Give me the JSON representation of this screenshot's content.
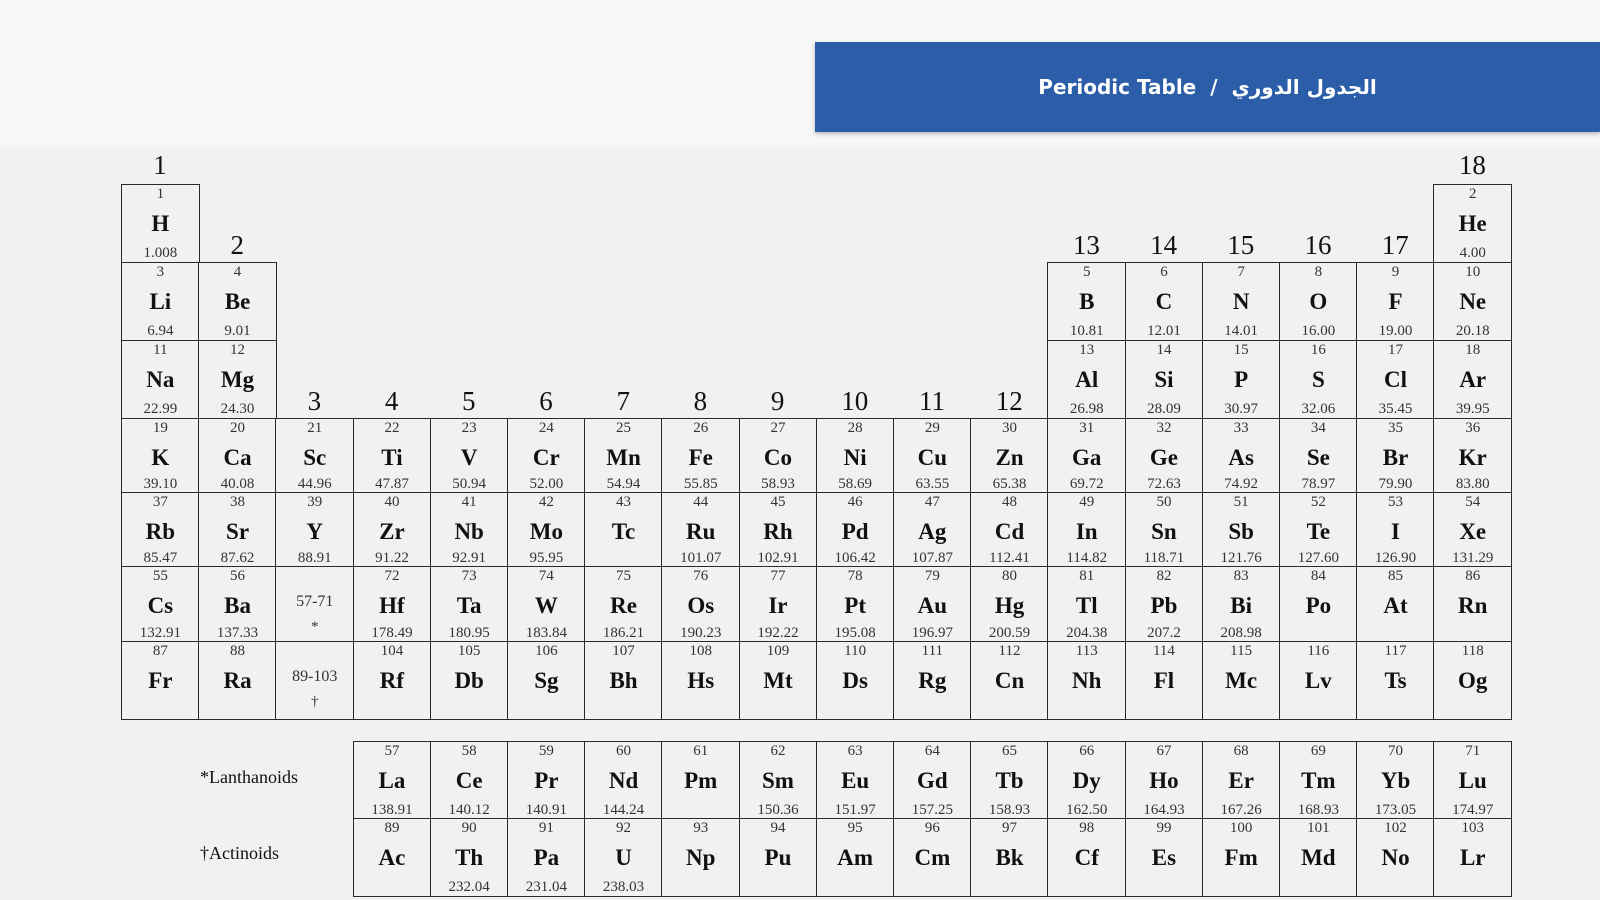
{
  "header": {
    "title_en": "Periodic Table",
    "separator": "/",
    "title_ar": "الجدول الدوري"
  },
  "colors": {
    "banner": "#2b5da9",
    "banner_text": "#ffffff",
    "cell_border": "#2a2a2a",
    "page_background": "#f1f1f1"
  },
  "groups": [
    "1",
    "2",
    "3",
    "4",
    "5",
    "6",
    "7",
    "8",
    "9",
    "10",
    "11",
    "12",
    "13",
    "14",
    "15",
    "16",
    "17",
    "18"
  ],
  "elements": [
    {
      "n": "1",
      "s": "H",
      "m": "1.008",
      "g": 1,
      "p": 1
    },
    {
      "n": "2",
      "s": "He",
      "m": "4.00",
      "g": 18,
      "p": 1
    },
    {
      "n": "3",
      "s": "Li",
      "m": "6.94",
      "g": 1,
      "p": 2
    },
    {
      "n": "4",
      "s": "Be",
      "m": "9.01",
      "g": 2,
      "p": 2
    },
    {
      "n": "5",
      "s": "B",
      "m": "10.81",
      "g": 13,
      "p": 2
    },
    {
      "n": "6",
      "s": "C",
      "m": "12.01",
      "g": 14,
      "p": 2
    },
    {
      "n": "7",
      "s": "N",
      "m": "14.01",
      "g": 15,
      "p": 2
    },
    {
      "n": "8",
      "s": "O",
      "m": "16.00",
      "g": 16,
      "p": 2
    },
    {
      "n": "9",
      "s": "F",
      "m": "19.00",
      "g": 17,
      "p": 2
    },
    {
      "n": "10",
      "s": "Ne",
      "m": "20.18",
      "g": 18,
      "p": 2
    },
    {
      "n": "11",
      "s": "Na",
      "m": "22.99",
      "g": 1,
      "p": 3
    },
    {
      "n": "12",
      "s": "Mg",
      "m": "24.30",
      "g": 2,
      "p": 3
    },
    {
      "n": "13",
      "s": "Al",
      "m": "26.98",
      "g": 13,
      "p": 3
    },
    {
      "n": "14",
      "s": "Si",
      "m": "28.09",
      "g": 14,
      "p": 3
    },
    {
      "n": "15",
      "s": "P",
      "m": "30.97",
      "g": 15,
      "p": 3
    },
    {
      "n": "16",
      "s": "S",
      "m": "32.06",
      "g": 16,
      "p": 3
    },
    {
      "n": "17",
      "s": "Cl",
      "m": "35.45",
      "g": 17,
      "p": 3
    },
    {
      "n": "18",
      "s": "Ar",
      "m": "39.95",
      "g": 18,
      "p": 3
    },
    {
      "n": "19",
      "s": "K",
      "m": "39.10",
      "g": 1,
      "p": 4
    },
    {
      "n": "20",
      "s": "Ca",
      "m": "40.08",
      "g": 2,
      "p": 4
    },
    {
      "n": "21",
      "s": "Sc",
      "m": "44.96",
      "g": 3,
      "p": 4
    },
    {
      "n": "22",
      "s": "Ti",
      "m": "47.87",
      "g": 4,
      "p": 4
    },
    {
      "n": "23",
      "s": "V",
      "m": "50.94",
      "g": 5,
      "p": 4
    },
    {
      "n": "24",
      "s": "Cr",
      "m": "52.00",
      "g": 6,
      "p": 4
    },
    {
      "n": "25",
      "s": "Mn",
      "m": "54.94",
      "g": 7,
      "p": 4
    },
    {
      "n": "26",
      "s": "Fe",
      "m": "55.85",
      "g": 8,
      "p": 4
    },
    {
      "n": "27",
      "s": "Co",
      "m": "58.93",
      "g": 9,
      "p": 4
    },
    {
      "n": "28",
      "s": "Ni",
      "m": "58.69",
      "g": 10,
      "p": 4
    },
    {
      "n": "29",
      "s": "Cu",
      "m": "63.55",
      "g": 11,
      "p": 4
    },
    {
      "n": "30",
      "s": "Zn",
      "m": "65.38",
      "g": 12,
      "p": 4
    },
    {
      "n": "31",
      "s": "Ga",
      "m": "69.72",
      "g": 13,
      "p": 4
    },
    {
      "n": "32",
      "s": "Ge",
      "m": "72.63",
      "g": 14,
      "p": 4
    },
    {
      "n": "33",
      "s": "As",
      "m": "74.92",
      "g": 15,
      "p": 4
    },
    {
      "n": "34",
      "s": "Se",
      "m": "78.97",
      "g": 16,
      "p": 4
    },
    {
      "n": "35",
      "s": "Br",
      "m": "79.90",
      "g": 17,
      "p": 4
    },
    {
      "n": "36",
      "s": "Kr",
      "m": "83.80",
      "g": 18,
      "p": 4
    },
    {
      "n": "37",
      "s": "Rb",
      "m": "85.47",
      "g": 1,
      "p": 5
    },
    {
      "n": "38",
      "s": "Sr",
      "m": "87.62",
      "g": 2,
      "p": 5
    },
    {
      "n": "39",
      "s": "Y",
      "m": "88.91",
      "g": 3,
      "p": 5
    },
    {
      "n": "40",
      "s": "Zr",
      "m": "91.22",
      "g": 4,
      "p": 5
    },
    {
      "n": "41",
      "s": "Nb",
      "m": "92.91",
      "g": 5,
      "p": 5
    },
    {
      "n": "42",
      "s": "Mo",
      "m": "95.95",
      "g": 6,
      "p": 5
    },
    {
      "n": "43",
      "s": "Tc",
      "m": "",
      "g": 7,
      "p": 5
    },
    {
      "n": "44",
      "s": "Ru",
      "m": "101.07",
      "g": 8,
      "p": 5
    },
    {
      "n": "45",
      "s": "Rh",
      "m": "102.91",
      "g": 9,
      "p": 5
    },
    {
      "n": "46",
      "s": "Pd",
      "m": "106.42",
      "g": 10,
      "p": 5
    },
    {
      "n": "47",
      "s": "Ag",
      "m": "107.87",
      "g": 11,
      "p": 5
    },
    {
      "n": "48",
      "s": "Cd",
      "m": "112.41",
      "g": 12,
      "p": 5
    },
    {
      "n": "49",
      "s": "In",
      "m": "114.82",
      "g": 13,
      "p": 5
    },
    {
      "n": "50",
      "s": "Sn",
      "m": "118.71",
      "g": 14,
      "p": 5
    },
    {
      "n": "51",
      "s": "Sb",
      "m": "121.76",
      "g": 15,
      "p": 5
    },
    {
      "n": "52",
      "s": "Te",
      "m": "127.60",
      "g": 16,
      "p": 5
    },
    {
      "n": "53",
      "s": "I",
      "m": "126.90",
      "g": 17,
      "p": 5
    },
    {
      "n": "54",
      "s": "Xe",
      "m": "131.29",
      "g": 18,
      "p": 5
    },
    {
      "n": "55",
      "s": "Cs",
      "m": "132.91",
      "g": 1,
      "p": 6
    },
    {
      "n": "56",
      "s": "Ba",
      "m": "137.33",
      "g": 2,
      "p": 6
    },
    {
      "n": "72",
      "s": "Hf",
      "m": "178.49",
      "g": 4,
      "p": 6
    },
    {
      "n": "73",
      "s": "Ta",
      "m": "180.95",
      "g": 5,
      "p": 6
    },
    {
      "n": "74",
      "s": "W",
      "m": "183.84",
      "g": 6,
      "p": 6
    },
    {
      "n": "75",
      "s": "Re",
      "m": "186.21",
      "g": 7,
      "p": 6
    },
    {
      "n": "76",
      "s": "Os",
      "m": "190.23",
      "g": 8,
      "p": 6
    },
    {
      "n": "77",
      "s": "Ir",
      "m": "192.22",
      "g": 9,
      "p": 6
    },
    {
      "n": "78",
      "s": "Pt",
      "m": "195.08",
      "g": 10,
      "p": 6
    },
    {
      "n": "79",
      "s": "Au",
      "m": "196.97",
      "g": 11,
      "p": 6
    },
    {
      "n": "80",
      "s": "Hg",
      "m": "200.59",
      "g": 12,
      "p": 6
    },
    {
      "n": "81",
      "s": "Tl",
      "m": "204.38",
      "g": 13,
      "p": 6
    },
    {
      "n": "82",
      "s": "Pb",
      "m": "207.2",
      "g": 14,
      "p": 6
    },
    {
      "n": "83",
      "s": "Bi",
      "m": "208.98",
      "g": 15,
      "p": 6
    },
    {
      "n": "84",
      "s": "Po",
      "m": "",
      "g": 16,
      "p": 6
    },
    {
      "n": "85",
      "s": "At",
      "m": "",
      "g": 17,
      "p": 6
    },
    {
      "n": "86",
      "s": "Rn",
      "m": "",
      "g": 18,
      "p": 6
    },
    {
      "n": "87",
      "s": "Fr",
      "m": "",
      "g": 1,
      "p": 7
    },
    {
      "n": "88",
      "s": "Ra",
      "m": "",
      "g": 2,
      "p": 7
    },
    {
      "n": "104",
      "s": "Rf",
      "m": "",
      "g": 4,
      "p": 7
    },
    {
      "n": "105",
      "s": "Db",
      "m": "",
      "g": 5,
      "p": 7
    },
    {
      "n": "106",
      "s": "Sg",
      "m": "",
      "g": 6,
      "p": 7
    },
    {
      "n": "107",
      "s": "Bh",
      "m": "",
      "g": 7,
      "p": 7
    },
    {
      "n": "108",
      "s": "Hs",
      "m": "",
      "g": 8,
      "p": 7
    },
    {
      "n": "109",
      "s": "Mt",
      "m": "",
      "g": 9,
      "p": 7
    },
    {
      "n": "110",
      "s": "Ds",
      "m": "",
      "g": 10,
      "p": 7
    },
    {
      "n": "111",
      "s": "Rg",
      "m": "",
      "g": 11,
      "p": 7
    },
    {
      "n": "112",
      "s": "Cn",
      "m": "",
      "g": 12,
      "p": 7
    },
    {
      "n": "113",
      "s": "Nh",
      "m": "",
      "g": 13,
      "p": 7
    },
    {
      "n": "114",
      "s": "Fl",
      "m": "",
      "g": 14,
      "p": 7
    },
    {
      "n": "115",
      "s": "Mc",
      "m": "",
      "g": 15,
      "p": 7
    },
    {
      "n": "116",
      "s": "Lv",
      "m": "",
      "g": 16,
      "p": 7
    },
    {
      "n": "117",
      "s": "Ts",
      "m": "",
      "g": 17,
      "p": 7
    },
    {
      "n": "118",
      "s": "Og",
      "m": "",
      "g": 18,
      "p": 7
    }
  ],
  "placeholders": [
    {
      "range": "57-71",
      "mark": "*",
      "g": 3,
      "p": 6
    },
    {
      "range": "89-103",
      "mark": "†",
      "g": 3,
      "p": 7
    }
  ],
  "f_block": {
    "lanthanoids_label": "*Lanthanoids",
    "actinoids_label": "†Actinoids",
    "lanthanoids": [
      {
        "n": "57",
        "s": "La",
        "m": "138.91"
      },
      {
        "n": "58",
        "s": "Ce",
        "m": "140.12"
      },
      {
        "n": "59",
        "s": "Pr",
        "m": "140.91"
      },
      {
        "n": "60",
        "s": "Nd",
        "m": "144.24"
      },
      {
        "n": "61",
        "s": "Pm",
        "m": ""
      },
      {
        "n": "62",
        "s": "Sm",
        "m": "150.36"
      },
      {
        "n": "63",
        "s": "Eu",
        "m": "151.97"
      },
      {
        "n": "64",
        "s": "Gd",
        "m": "157.25"
      },
      {
        "n": "65",
        "s": "Tb",
        "m": "158.93"
      },
      {
        "n": "66",
        "s": "Dy",
        "m": "162.50"
      },
      {
        "n": "67",
        "s": "Ho",
        "m": "164.93"
      },
      {
        "n": "68",
        "s": "Er",
        "m": "167.26"
      },
      {
        "n": "69",
        "s": "Tm",
        "m": "168.93"
      },
      {
        "n": "70",
        "s": "Yb",
        "m": "173.05"
      },
      {
        "n": "71",
        "s": "Lu",
        "m": "174.97"
      }
    ],
    "actinoids": [
      {
        "n": "89",
        "s": "Ac",
        "m": ""
      },
      {
        "n": "90",
        "s": "Th",
        "m": "232.04"
      },
      {
        "n": "91",
        "s": "Pa",
        "m": "231.04"
      },
      {
        "n": "92",
        "s": "U",
        "m": "238.03"
      },
      {
        "n": "93",
        "s": "Np",
        "m": ""
      },
      {
        "n": "94",
        "s": "Pu",
        "m": ""
      },
      {
        "n": "95",
        "s": "Am",
        "m": ""
      },
      {
        "n": "96",
        "s": "Cm",
        "m": ""
      },
      {
        "n": "97",
        "s": "Bk",
        "m": ""
      },
      {
        "n": "98",
        "s": "Cf",
        "m": ""
      },
      {
        "n": "99",
        "s": "Es",
        "m": ""
      },
      {
        "n": "100",
        "s": "Fm",
        "m": ""
      },
      {
        "n": "101",
        "s": "Md",
        "m": ""
      },
      {
        "n": "102",
        "s": "No",
        "m": ""
      },
      {
        "n": "103",
        "s": "Lr",
        "m": ""
      }
    ]
  }
}
